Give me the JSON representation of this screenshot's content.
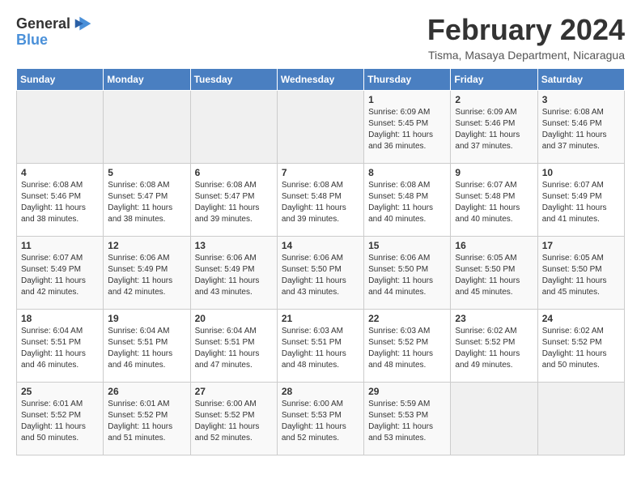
{
  "header": {
    "logo_line1": "General",
    "logo_line2": "Blue",
    "month": "February 2024",
    "location": "Tisma, Masaya Department, Nicaragua"
  },
  "weekdays": [
    "Sunday",
    "Monday",
    "Tuesday",
    "Wednesday",
    "Thursday",
    "Friday",
    "Saturday"
  ],
  "weeks": [
    [
      {
        "day": "",
        "info": ""
      },
      {
        "day": "",
        "info": ""
      },
      {
        "day": "",
        "info": ""
      },
      {
        "day": "",
        "info": ""
      },
      {
        "day": "1",
        "info": "Sunrise: 6:09 AM\nSunset: 5:45 PM\nDaylight: 11 hours\nand 36 minutes."
      },
      {
        "day": "2",
        "info": "Sunrise: 6:09 AM\nSunset: 5:46 PM\nDaylight: 11 hours\nand 37 minutes."
      },
      {
        "day": "3",
        "info": "Sunrise: 6:08 AM\nSunset: 5:46 PM\nDaylight: 11 hours\nand 37 minutes."
      }
    ],
    [
      {
        "day": "4",
        "info": "Sunrise: 6:08 AM\nSunset: 5:46 PM\nDaylight: 11 hours\nand 38 minutes."
      },
      {
        "day": "5",
        "info": "Sunrise: 6:08 AM\nSunset: 5:47 PM\nDaylight: 11 hours\nand 38 minutes."
      },
      {
        "day": "6",
        "info": "Sunrise: 6:08 AM\nSunset: 5:47 PM\nDaylight: 11 hours\nand 39 minutes."
      },
      {
        "day": "7",
        "info": "Sunrise: 6:08 AM\nSunset: 5:48 PM\nDaylight: 11 hours\nand 39 minutes."
      },
      {
        "day": "8",
        "info": "Sunrise: 6:08 AM\nSunset: 5:48 PM\nDaylight: 11 hours\nand 40 minutes."
      },
      {
        "day": "9",
        "info": "Sunrise: 6:07 AM\nSunset: 5:48 PM\nDaylight: 11 hours\nand 40 minutes."
      },
      {
        "day": "10",
        "info": "Sunrise: 6:07 AM\nSunset: 5:49 PM\nDaylight: 11 hours\nand 41 minutes."
      }
    ],
    [
      {
        "day": "11",
        "info": "Sunrise: 6:07 AM\nSunset: 5:49 PM\nDaylight: 11 hours\nand 42 minutes."
      },
      {
        "day": "12",
        "info": "Sunrise: 6:06 AM\nSunset: 5:49 PM\nDaylight: 11 hours\nand 42 minutes."
      },
      {
        "day": "13",
        "info": "Sunrise: 6:06 AM\nSunset: 5:49 PM\nDaylight: 11 hours\nand 43 minutes."
      },
      {
        "day": "14",
        "info": "Sunrise: 6:06 AM\nSunset: 5:50 PM\nDaylight: 11 hours\nand 43 minutes."
      },
      {
        "day": "15",
        "info": "Sunrise: 6:06 AM\nSunset: 5:50 PM\nDaylight: 11 hours\nand 44 minutes."
      },
      {
        "day": "16",
        "info": "Sunrise: 6:05 AM\nSunset: 5:50 PM\nDaylight: 11 hours\nand 45 minutes."
      },
      {
        "day": "17",
        "info": "Sunrise: 6:05 AM\nSunset: 5:50 PM\nDaylight: 11 hours\nand 45 minutes."
      }
    ],
    [
      {
        "day": "18",
        "info": "Sunrise: 6:04 AM\nSunset: 5:51 PM\nDaylight: 11 hours\nand 46 minutes."
      },
      {
        "day": "19",
        "info": "Sunrise: 6:04 AM\nSunset: 5:51 PM\nDaylight: 11 hours\nand 46 minutes."
      },
      {
        "day": "20",
        "info": "Sunrise: 6:04 AM\nSunset: 5:51 PM\nDaylight: 11 hours\nand 47 minutes."
      },
      {
        "day": "21",
        "info": "Sunrise: 6:03 AM\nSunset: 5:51 PM\nDaylight: 11 hours\nand 48 minutes."
      },
      {
        "day": "22",
        "info": "Sunrise: 6:03 AM\nSunset: 5:52 PM\nDaylight: 11 hours\nand 48 minutes."
      },
      {
        "day": "23",
        "info": "Sunrise: 6:02 AM\nSunset: 5:52 PM\nDaylight: 11 hours\nand 49 minutes."
      },
      {
        "day": "24",
        "info": "Sunrise: 6:02 AM\nSunset: 5:52 PM\nDaylight: 11 hours\nand 50 minutes."
      }
    ],
    [
      {
        "day": "25",
        "info": "Sunrise: 6:01 AM\nSunset: 5:52 PM\nDaylight: 11 hours\nand 50 minutes."
      },
      {
        "day": "26",
        "info": "Sunrise: 6:01 AM\nSunset: 5:52 PM\nDaylight: 11 hours\nand 51 minutes."
      },
      {
        "day": "27",
        "info": "Sunrise: 6:00 AM\nSunset: 5:52 PM\nDaylight: 11 hours\nand 52 minutes."
      },
      {
        "day": "28",
        "info": "Sunrise: 6:00 AM\nSunset: 5:53 PM\nDaylight: 11 hours\nand 52 minutes."
      },
      {
        "day": "29",
        "info": "Sunrise: 5:59 AM\nSunset: 5:53 PM\nDaylight: 11 hours\nand 53 minutes."
      },
      {
        "day": "",
        "info": ""
      },
      {
        "day": "",
        "info": ""
      }
    ]
  ]
}
